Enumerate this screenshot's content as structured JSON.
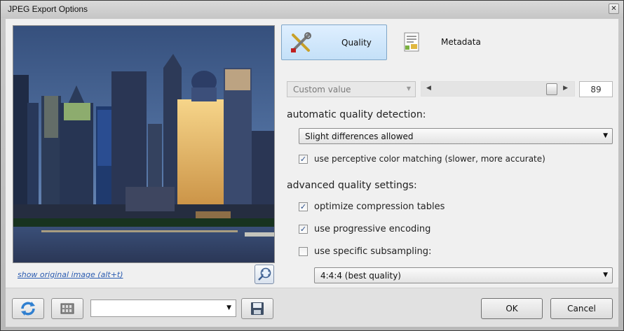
{
  "window": {
    "title": "JPEG Export Options",
    "close_glyph": "✕"
  },
  "preview": {
    "show_original_link": "show original image (alt+t)",
    "zoom_icon": "zoom-icon"
  },
  "tabs": [
    {
      "label": "Quality",
      "icon": "tools-icon",
      "selected": true
    },
    {
      "label": "Metadata",
      "icon": "document-icon",
      "selected": false
    }
  ],
  "quality": {
    "preset_select": "Custom value",
    "slider_value": 89,
    "slider_max": 100,
    "value_text": "89"
  },
  "auto_detection": {
    "heading": "automatic quality detection:",
    "mode": "Slight differences allowed",
    "perceptive_label": "use perceptive color matching (slower, more accurate)",
    "perceptive_checked": true
  },
  "advanced": {
    "heading": "advanced quality settings:",
    "options": [
      {
        "label": "optimize compression tables",
        "checked": true
      },
      {
        "label": "use progressive encoding",
        "checked": true
      },
      {
        "label": "use specific subsampling:",
        "checked": false
      }
    ],
    "subsampling": "4:4:4 (best quality)"
  },
  "footer": {
    "preset_name": "",
    "ok_label": "OK",
    "cancel_label": "Cancel"
  },
  "colors": {
    "accent_tab": "#c4e0f8",
    "check_mark": "#2a4e8a",
    "link": "#2a5bb0"
  }
}
